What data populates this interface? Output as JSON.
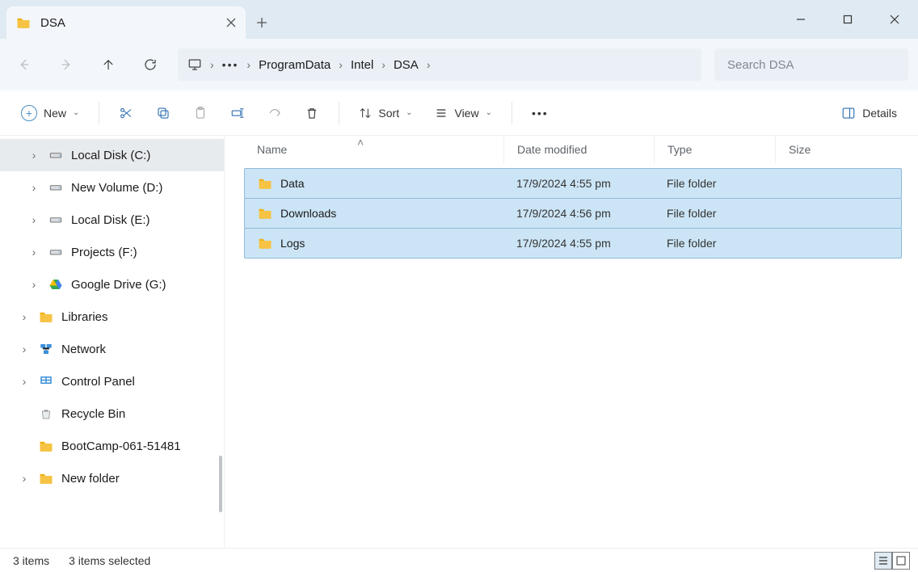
{
  "tab": {
    "title": "DSA"
  },
  "breadcrumbs": {
    "items": [
      "ProgramData",
      "Intel",
      "DSA"
    ]
  },
  "search": {
    "placeholder": "Search DSA"
  },
  "toolbar": {
    "new_label": "New",
    "sort_label": "Sort",
    "view_label": "View",
    "details_label": "Details"
  },
  "columns": {
    "name": "Name",
    "date": "Date modified",
    "type": "Type",
    "size": "Size"
  },
  "files": [
    {
      "name": "Data",
      "date": "17/9/2024 4:55 pm",
      "type": "File folder"
    },
    {
      "name": "Downloads",
      "date": "17/9/2024 4:56 pm",
      "type": "File folder"
    },
    {
      "name": "Logs",
      "date": "17/9/2024 4:55 pm",
      "type": "File folder"
    }
  ],
  "tree": [
    {
      "label": "Local Disk (C:)",
      "indent": 2,
      "chev": true,
      "icon": "drive",
      "sel": true
    },
    {
      "label": "New Volume (D:)",
      "indent": 2,
      "chev": true,
      "icon": "drive"
    },
    {
      "label": "Local Disk (E:)",
      "indent": 2,
      "chev": true,
      "icon": "drive"
    },
    {
      "label": "Projects (F:)",
      "indent": 2,
      "chev": true,
      "icon": "drive"
    },
    {
      "label": "Google Drive (G:)",
      "indent": 2,
      "chev": true,
      "icon": "gdrive"
    },
    {
      "label": "Libraries",
      "indent": 1,
      "chev": true,
      "icon": "folder"
    },
    {
      "label": "Network",
      "indent": 1,
      "chev": true,
      "icon": "network"
    },
    {
      "label": "Control Panel",
      "indent": 1,
      "chev": true,
      "icon": "cpanel"
    },
    {
      "label": "Recycle Bin",
      "indent": 1,
      "chev": false,
      "icon": "recycle"
    },
    {
      "label": "BootCamp-061-51481",
      "indent": 1,
      "chev": false,
      "icon": "folder"
    },
    {
      "label": "New folder",
      "indent": 1,
      "chev": true,
      "icon": "folder"
    }
  ],
  "status": {
    "count": "3 items",
    "selected": "3 items selected"
  }
}
